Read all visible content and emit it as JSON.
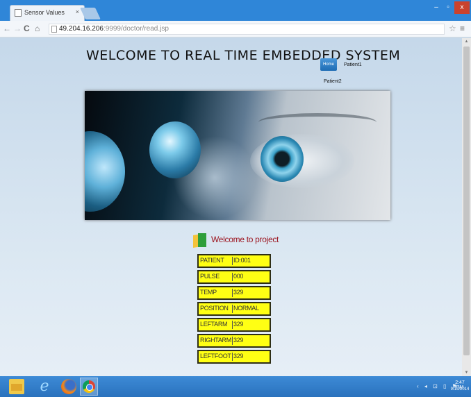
{
  "browser": {
    "tab_title": "Sensor Values",
    "tab_close": "×",
    "url_host": "49.204.16.206",
    "url_rest": ":9999/doctor/read.jsp",
    "window_min": "–",
    "window_max": "▫",
    "window_close": "x"
  },
  "icons": {
    "back": "←",
    "forward": "→",
    "reload": "C",
    "home": "⌂",
    "star": "☆",
    "menu": "≡"
  },
  "site": {
    "title": "WELCOME TO REAL TIME EMBEDDED SYSTEM",
    "nav": {
      "home": "Home",
      "patient1": "Patient1",
      "patient2": "Patient2"
    }
  },
  "welcome": "Welcome to project",
  "sensor_table": [
    {
      "label": "PATIENT",
      "value": "ID:001"
    },
    {
      "label": "PULSE",
      "value": "000"
    },
    {
      "label": "TEMP",
      "value": "329"
    },
    {
      "label": "POSITION",
      "value": "NORMAL"
    },
    {
      "label": "LEFTARM",
      "value": "329"
    },
    {
      "label": "RIGHTARM",
      "value": "329"
    },
    {
      "label": "LEFTFOOT",
      "value": "329"
    }
  ],
  "taskbar": {
    "time": "2:47 PM",
    "date": "9/13/2014",
    "tray": "‹ ◂ ⊡ ▯ ⚑"
  },
  "colors": {
    "table_cell": "#ffff14",
    "table_border": "#2e2e16",
    "welcome_text": "#9d1520",
    "titlebar": "#2f86d8"
  }
}
